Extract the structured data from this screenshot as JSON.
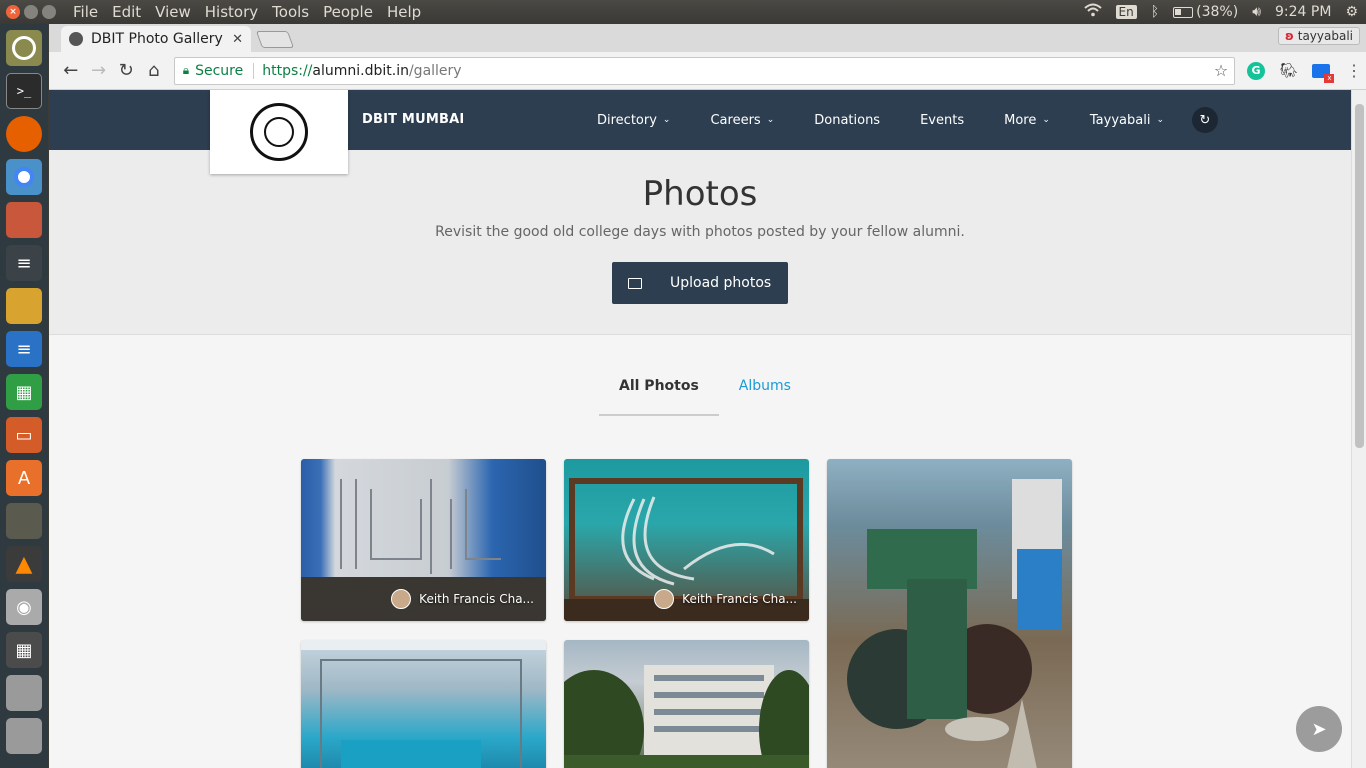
{
  "panel": {
    "menu": [
      "File",
      "Edit",
      "View",
      "History",
      "Tools",
      "People",
      "Help"
    ],
    "lang": "En",
    "battery": "(38%)",
    "time": "9:24 PM"
  },
  "browser": {
    "tab_title": "DBIT Photo Gallery",
    "profile": "tayyabali",
    "secure_label": "Secure",
    "url_scheme": "https://",
    "url_host": "alumni.dbit.in",
    "url_path": "/gallery"
  },
  "site": {
    "brand": "DBIT MUMBAI",
    "nav": [
      {
        "label": "Directory",
        "dropdown": true
      },
      {
        "label": "Careers",
        "dropdown": true
      },
      {
        "label": "Donations",
        "dropdown": false
      },
      {
        "label": "Events",
        "dropdown": false
      },
      {
        "label": "More",
        "dropdown": true
      },
      {
        "label": "Tayyabali",
        "dropdown": true
      }
    ]
  },
  "hero": {
    "title": "Photos",
    "subtitle": "Revisit the good old college days with photos posted by your fellow alumni.",
    "upload_label": "Upload photos"
  },
  "gallery": {
    "tabs": [
      {
        "label": "All Photos",
        "active": true
      },
      {
        "label": "Albums",
        "active": false
      }
    ],
    "photos": [
      {
        "author": "Keith Francis Cha..."
      },
      {
        "author": "Keith Francis Cha..."
      }
    ]
  }
}
